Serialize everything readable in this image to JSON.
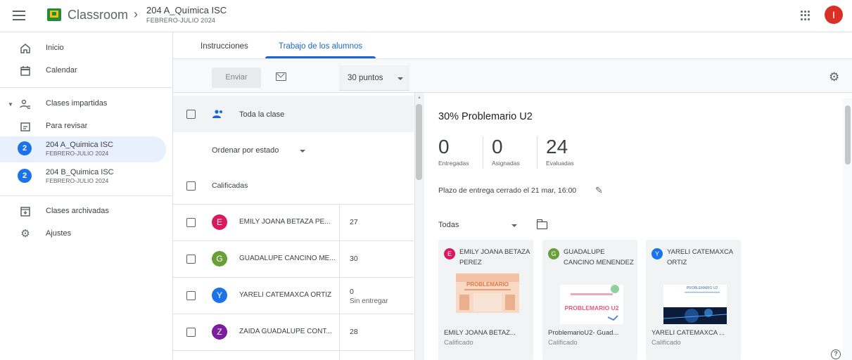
{
  "header": {
    "app_title": "Classroom",
    "breadcrumb_sep": "›",
    "class_title": "204 A_Química ISC",
    "class_subtitle": "FEBRERO-JULIO 2024",
    "user_initial": "I"
  },
  "sidebar": {
    "home": "Inicio",
    "calendar": "Calendar",
    "taught": "Clases impartidas",
    "to_review": "Para revisar",
    "classes": [
      {
        "badge": "2",
        "name": "204 A_Quimica ISC",
        "term": "FEBRERO-JULIO 2024"
      },
      {
        "badge": "2",
        "name": "204 B_Quimica ISC",
        "term": "FEBRERO-JULIO 2024"
      }
    ],
    "archived": "Clases archivadas",
    "settings": "Ajustes"
  },
  "tabs": {
    "instructions": "Instrucciones",
    "student_work": "Trabajo de los alumnos"
  },
  "toolbar": {
    "send": "Enviar",
    "points": "30 puntos"
  },
  "list": {
    "all_class": "Toda la clase",
    "sort_by": "Ordenar por estado",
    "graded": "Calificadas",
    "students": [
      {
        "initial": "E",
        "color": "#d81b60",
        "name": "EMILY JOANA BETAZA PE...",
        "grade": "27"
      },
      {
        "initial": "G",
        "color": "#689f38",
        "name": "GUADALUPE CANCINO ME...",
        "grade": "30"
      },
      {
        "initial": "Y",
        "color": "#1a73e8",
        "name": "YARELI CATEMAXCA ORTIZ",
        "grade": "0",
        "note": "Sin entregar"
      },
      {
        "initial": "Z",
        "color": "#7b1fa2",
        "name": "ZAIDA GUADALUPE CONT...",
        "grade": "28"
      }
    ]
  },
  "detail": {
    "title": "30% Problemario U2",
    "stats": [
      {
        "value": "0",
        "label": "Entregadas"
      },
      {
        "value": "0",
        "label": "Asignadas"
      },
      {
        "value": "24",
        "label": "Evaluadas"
      }
    ],
    "deadline": "Plazo de entrega cerrado el 21 mar, 16:00",
    "filter": "Todas",
    "cards": [
      {
        "initial": "E",
        "color": "#d81b60",
        "name": "EMILY JOANA BETAZA PEREZ",
        "file": "EMILY JOANA BETAZ...",
        "status": "Calificado",
        "thumb_text": "PROBLEMARIO"
      },
      {
        "initial": "G",
        "color": "#689f38",
        "name": "GUADALUPE CANCINO MENENDEZ",
        "file": "ProblemarioU2- Guad...",
        "status": "Calificado",
        "thumb_text": "PROBLEMARIO U2"
      },
      {
        "initial": "Y",
        "color": "#1a73e8",
        "name": "YARELI CATEMAXCA ORTIZ",
        "file": "YARELI CATEMAXCA ...",
        "status": "Calificado",
        "thumb_text": "PROBLEMARIO U2"
      }
    ]
  },
  "help": "?"
}
